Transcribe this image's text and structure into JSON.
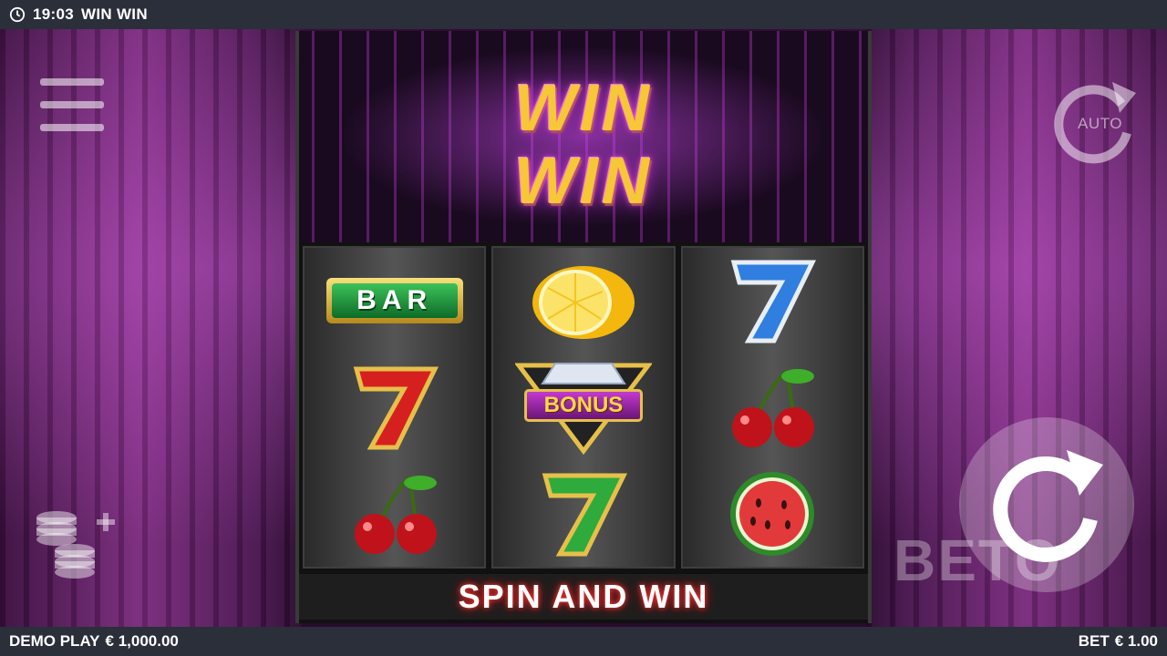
{
  "topbar": {
    "time": "19:03",
    "game_title": "WIN WIN"
  },
  "logo": {
    "line1": "WIN",
    "line2": "WIN"
  },
  "side": {
    "auto_label": "AUTO"
  },
  "reels": [
    {
      "symbols": [
        {
          "label": "BAR",
          "type": "bar"
        },
        {
          "type": "seven",
          "color": "#d62020"
        },
        {
          "type": "cherries"
        }
      ]
    },
    {
      "symbols": [
        {
          "type": "lemon"
        },
        {
          "label": "BONUS",
          "type": "bonus"
        },
        {
          "type": "seven",
          "color": "#2faa3c"
        }
      ]
    },
    {
      "symbols": [
        {
          "type": "seven",
          "color": "#2f7ee0"
        },
        {
          "type": "cherries"
        },
        {
          "type": "watermelon"
        }
      ]
    }
  ],
  "tagline": "SPIN AND WIN",
  "watermark": "BETO",
  "bottombar": {
    "mode": "DEMO PLAY",
    "balance": "€ 1,000.00",
    "bet_label": "BET",
    "bet_value": "€ 1.00"
  },
  "colors": {
    "accent": "#f6c736",
    "panel": "#2a2f3a",
    "neon": "#c23ad0"
  }
}
